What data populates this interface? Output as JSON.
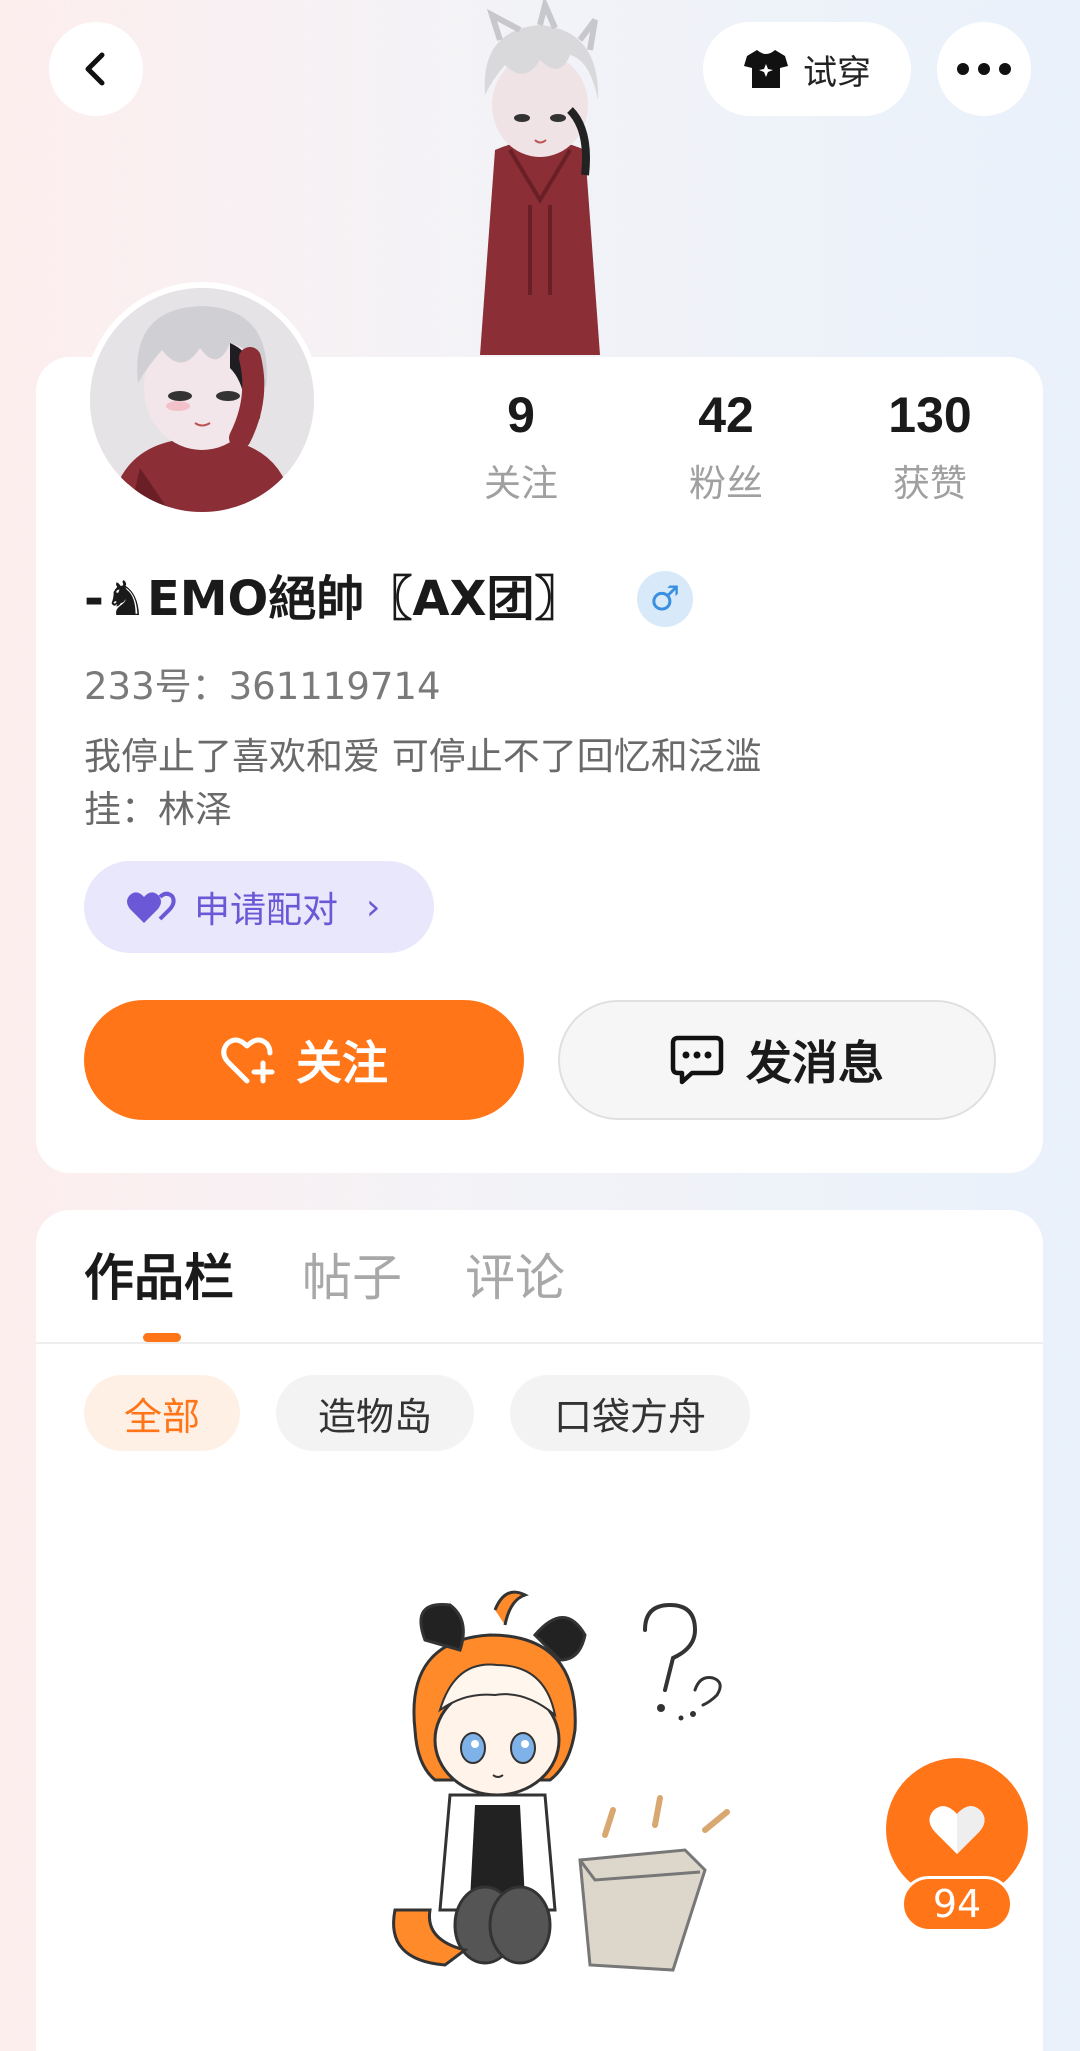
{
  "header": {
    "try_on_label": "试穿"
  },
  "profile": {
    "stats": [
      {
        "value": "9",
        "label": "关注"
      },
      {
        "value": "42",
        "label": "粉丝"
      },
      {
        "value": "130",
        "label": "获赞"
      }
    ],
    "username": "-♞EMO絕帥〖AX团〗",
    "gender_symbol": "♂",
    "uid": "233号：361119714",
    "bio_line1": "我停止了喜欢和爱 可停止不了回忆和泛滥",
    "bio_line2": "挂：林泽",
    "pair_label": "申请配对",
    "pair_chevron": "›",
    "follow_label": "关注",
    "message_label": "发消息"
  },
  "tabs": [
    {
      "label": "作品栏"
    },
    {
      "label": "帖子"
    },
    {
      "label": "评论"
    }
  ],
  "filters": [
    {
      "label": "全部"
    },
    {
      "label": "造物岛"
    },
    {
      "label": "口袋方舟"
    }
  ],
  "like_fab": {
    "count": "94"
  },
  "colors": {
    "accent": "#ff7518",
    "pair_purple": "#6a58d6",
    "gender_blue": "#3a8fe0"
  },
  "icons": [
    "back-arrow-icon",
    "shirt-icon",
    "more-dots-icon",
    "heart-pair-icon",
    "heart-plus-icon",
    "chat-bubble-icon",
    "heart-icon"
  ]
}
